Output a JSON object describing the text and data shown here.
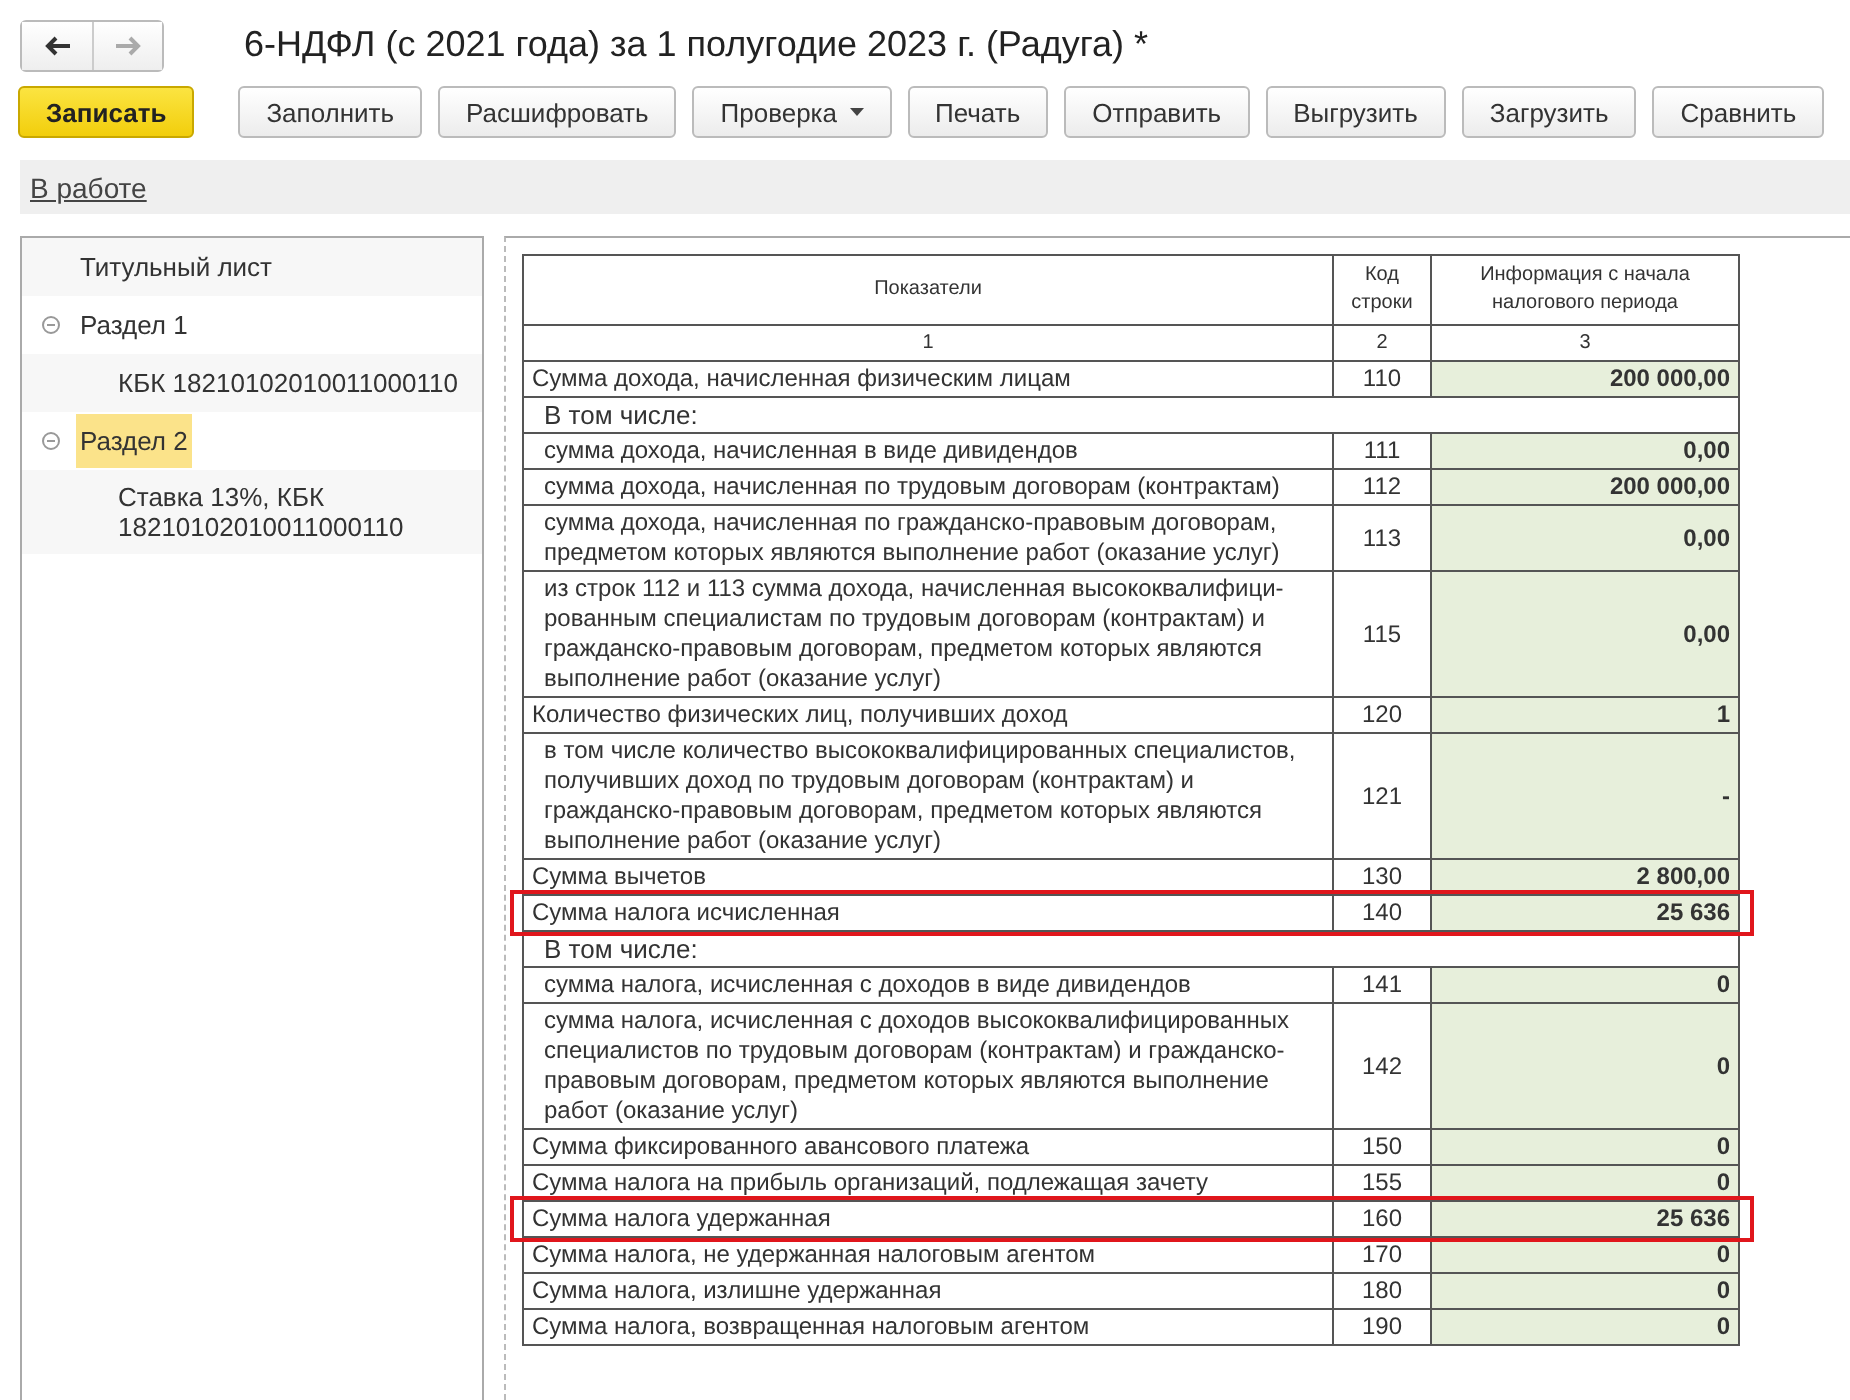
{
  "window": {
    "title": "6-НДФЛ (с 2021 года) за 1 полугодие 2023 г. (Радуга) *"
  },
  "toolbar": {
    "buttons": [
      {
        "label": "Записать",
        "kind": "primary"
      },
      {
        "label": "Заполнить",
        "kind": "plain"
      },
      {
        "label": "Расшифровать",
        "kind": "plain"
      },
      {
        "label": "Проверка",
        "kind": "dropdown"
      },
      {
        "label": "Печать",
        "kind": "plain"
      },
      {
        "label": "Отправить",
        "kind": "plain"
      },
      {
        "label": "Выгрузить",
        "kind": "plain"
      },
      {
        "label": "Загрузить",
        "kind": "plain"
      },
      {
        "label": "Сравнить",
        "kind": "plain"
      }
    ]
  },
  "status_link": "В работе",
  "sidebar": {
    "items": [
      {
        "label": "Титульный лист",
        "selected": false
      },
      {
        "label": "Раздел 1",
        "selected": false,
        "expanded": true,
        "children": [
          {
            "label": "КБК 18210102010011000110",
            "selected": false
          }
        ]
      },
      {
        "label": "Раздел 2",
        "selected": true,
        "expanded": true,
        "children": [
          {
            "label": "Ставка 13%, КБК 18210102010011000110",
            "selected": false
          }
        ]
      }
    ]
  },
  "table": {
    "columns": [
      "Показатели",
      "Код строки",
      "Информация с начала налогового периода"
    ],
    "column_numbers": [
      "1",
      "2",
      "3"
    ],
    "rows": [
      {
        "kind": "row",
        "text": "Сумма дохода, начисленная физическим лицам",
        "code": "110",
        "value": "200 000,00",
        "indented": false,
        "highlighted": false
      },
      {
        "kind": "subheader",
        "text": "В том числе:"
      },
      {
        "kind": "row",
        "text": "сумма дохода, начисленная в виде дивидендов",
        "code": "111",
        "value": "0,00",
        "indented": true,
        "highlighted": false
      },
      {
        "kind": "row",
        "text": "сумма дохода, начисленная по трудовым договорам (контрактам)",
        "code": "112",
        "value": "200 000,00",
        "indented": true,
        "highlighted": false
      },
      {
        "kind": "row",
        "text": "сумма дохода, начисленная по гражданско-правовым договорам, предметом которых являются выполнение работ (оказание услуг)",
        "code": "113",
        "value": "0,00",
        "indented": true,
        "highlighted": false
      },
      {
        "kind": "row",
        "text": "из строк 112 и 113 сумма дохода, начисленная высококвалифици-рованным специалистам по трудовым договорам (контрактам) и гражданско-правовым договорам, предметом которых являются выполнение работ (оказание услуг)",
        "code": "115",
        "value": "0,00",
        "indented": true,
        "highlighted": false
      },
      {
        "kind": "row",
        "text": "Количество физических лиц, получивших доход",
        "code": "120",
        "value": "1",
        "indented": false,
        "highlighted": false
      },
      {
        "kind": "row",
        "text": "в том числе количество высококвалифицированных специалистов, получивших доход по трудовым договорам (контрактам) и гражданско-правовым договорам, предметом которых являются выполнение работ (оказание услуг)",
        "code": "121",
        "value": "-",
        "indented": true,
        "highlighted": false
      },
      {
        "kind": "row",
        "text": "Сумма вычетов",
        "code": "130",
        "value": "2 800,00",
        "indented": false,
        "highlighted": false
      },
      {
        "kind": "row",
        "text": "Сумма налога исчисленная",
        "code": "140",
        "value": "25 636",
        "indented": false,
        "highlighted": true
      },
      {
        "kind": "subheader",
        "text": "В том числе:"
      },
      {
        "kind": "row",
        "text": "сумма налога, исчисленная с доходов в виде дивидендов",
        "code": "141",
        "value": "0",
        "indented": true,
        "highlighted": false
      },
      {
        "kind": "row",
        "text": "сумма налога, исчисленная с доходов высококвалифицированных специалистов по трудовым договорам (контрактам) и гражданско-правовым договорам, предметом которых являются выполнение работ (оказание услуг)",
        "code": "142",
        "value": "0",
        "indented": true,
        "highlighted": false
      },
      {
        "kind": "row",
        "text": "Сумма фиксированного авансового платежа",
        "code": "150",
        "value": "0",
        "indented": false,
        "highlighted": false
      },
      {
        "kind": "row",
        "text": "Сумма налога на прибыль организаций, подлежащая зачету",
        "code": "155",
        "value": "0",
        "indented": false,
        "highlighted": false
      },
      {
        "kind": "row",
        "text": "Сумма налога удержанная",
        "code": "160",
        "value": "25 636",
        "indented": false,
        "highlighted": true
      },
      {
        "kind": "row",
        "text": "Сумма налога, не удержанная налоговым агентом",
        "code": "170",
        "value": "0",
        "indented": false,
        "highlighted": false
      },
      {
        "kind": "row",
        "text": "Сумма налога, излишне удержанная",
        "code": "180",
        "value": "0",
        "indented": false,
        "highlighted": false
      },
      {
        "kind": "row",
        "text": "Сумма налога, возвращенная налоговым агентом",
        "code": "190",
        "value": "0",
        "indented": false,
        "highlighted": false
      }
    ]
  }
}
